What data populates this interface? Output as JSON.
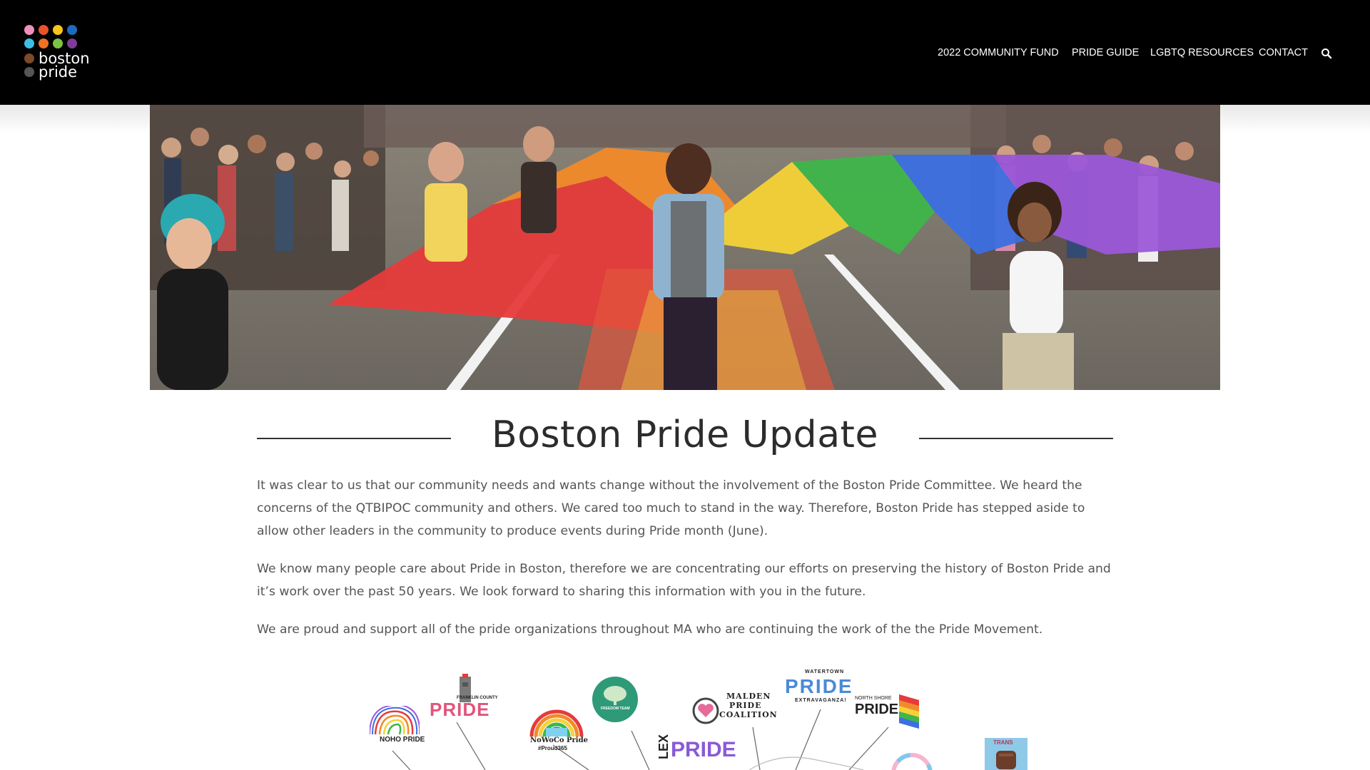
{
  "logo": {
    "line1": "boston",
    "line2": "pride",
    "dot_colors": [
      "#ef8fc0",
      "#e8532a",
      "#f7c51b",
      "#1b6cc1",
      "#3cbfe6",
      "#f27024",
      "#7cc243",
      "#7e3c98",
      "#7a4a2a",
      "#555555"
    ]
  },
  "nav": {
    "items": [
      "2022 COMMUNITY FUND",
      "PRIDE GUIDE",
      "LGBTQ RESOURCES",
      "CONTACT"
    ],
    "search_icon": "search-icon"
  },
  "hero": {
    "alt": "Pride parade with rainbow flag",
    "flag_colors": [
      "#e63b3b",
      "#f28a2a",
      "#f5d237",
      "#3fb64a",
      "#3c6fe0",
      "#9b58d8"
    ]
  },
  "main": {
    "title": "Boston Pride Update",
    "paragraphs": [
      "It was clear to us that our community needs and wants change without the involvement of the Boston Pride Committee. We heard the concerns of the QTBIPOC community and others. We cared too much to stand in the way. Therefore, Boston Pride has stepped aside to allow other leaders in the community to produce events during Pride month (June).",
      "We know many people care about Pride in Boston, therefore we are concentrating our efforts on preserving the history of Boston Pride and it’s work over the past 50 years. We look forward to sharing this information with you in the future.",
      "We are proud and support all of the pride organizations throughout MA who are continuing the work of the the Pride Movement."
    ]
  },
  "orgs": {
    "noho": "NOHO PRIDE",
    "franklin_top": "FRANKLIN COUNTY",
    "franklin": "PRIDE",
    "nowoco": "NoWoCo Pride",
    "nowoco_tag": "#Proud365",
    "freedom": "FREEDOM TEAM",
    "malden": [
      "MALDEN",
      "PRIDE",
      "COALITION"
    ],
    "watertown_top": "WATERTOWN",
    "watertown": "PRIDE",
    "watertown_sub": "EXTRAVAGANZA!",
    "northshore_top": "NORTH SHORE",
    "northshore": "PRIDE",
    "lex": "LEX",
    "lex_pride": "PRIDE",
    "trans": "TRANS"
  }
}
